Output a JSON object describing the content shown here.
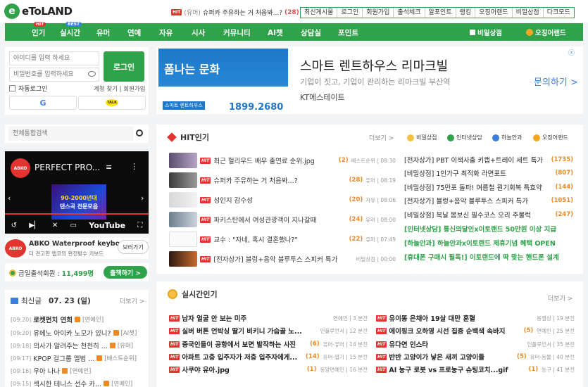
{
  "header": {
    "logo_text": "eToLAND",
    "logo_letter": "e",
    "ticker": {
      "badge": "HIT",
      "category": "(유머)",
      "title": "슈퍼카 주유하는 거 처음봐...?",
      "count": "(28)"
    },
    "top_links": [
      "최신게시물",
      "로그인",
      "회원가입",
      "출석체크",
      "알포인트",
      "랭킹",
      "오징어랜드",
      "비밀상점",
      "다크모드"
    ]
  },
  "nav": {
    "items": [
      {
        "label": "인기",
        "badge": "HIT"
      },
      {
        "label": "실시간",
        "badge": "BEST"
      },
      {
        "label": "유머"
      },
      {
        "label": "연예"
      },
      {
        "label": "자유"
      },
      {
        "label": "시사"
      },
      {
        "label": "커뮤니티"
      },
      {
        "label": "AI챗"
      },
      {
        "label": "상담실"
      },
      {
        "label": "포인트"
      }
    ],
    "right": [
      "비밀상점",
      "오징어랜드"
    ]
  },
  "login": {
    "id_placeholder": "아이디를 입력 하세요",
    "pw_placeholder": "비밀번호를 입력하세요",
    "button": "로그인",
    "auto_login": "자동로그인",
    "find_account": "계정 찾기 | 회원가입",
    "google": "G",
    "kakao": "TALK"
  },
  "search": {
    "placeholder": "전체통합검색"
  },
  "video": {
    "channel_logo": "ABKO",
    "title": "PERFECT PRO...",
    "art_line1": "90-2000년대",
    "art_line2": "댄스곡 전문모음",
    "youtube": "YouTube"
  },
  "ad_abko": {
    "logo": "ABKO",
    "title": "ABKO Waterproof keybo...",
    "subtitle": "더 견고한 앱코의 완전방수 키보드",
    "button": "보러가기"
  },
  "attendance": {
    "label": "금일출석회원 :",
    "count": "11,499명",
    "button": "출책하기 >"
  },
  "latest": {
    "heading": "최신글",
    "date": "07. 23 (일)",
    "more": "더보기 >",
    "rows": [
      {
        "time": "[09:20]",
        "title": "로켓펀치 연희",
        "cat": "[연예인]",
        "bold": true
      },
      {
        "time": "[09:20]",
        "title": "유메노 아이카 노모가 있니?",
        "cat": "[AI챗]",
        "bold": false
      },
      {
        "time": "[09:18]",
        "title": "의사가 알려주는 천천히 ...",
        "cat": "[유머]",
        "bold": false
      },
      {
        "time": "[09:17]",
        "title": "KPOP 걸그룹 앨범 ...",
        "cat": "[베스트순위]",
        "bold": false
      },
      {
        "time": "[09:16]",
        "title": "우아 나나",
        "cat": "[연예인]",
        "bold": false
      },
      {
        "time": "[09:15]",
        "title": "섹시한 테니스 선수 카...",
        "cat": "[연예인]",
        "bold": false
      }
    ]
  },
  "ad_banner": {
    "img_text": "폼나는 문화",
    "img_label": "스마트 렌트하우스",
    "img_phone": "1899.2680",
    "title": "스마트 렌트하우스 리마크빌",
    "desc": "기업이 짓고, 기업이 관리하는 리마크빌 부산역",
    "brand": "KT에스테이트",
    "cta": "문의하기 >",
    "close": "ⓧ"
  },
  "hit": {
    "title": "HIT인기",
    "more": "더보기 >",
    "tags": [
      "비밀상점",
      "인터넷상담",
      "하늘안과",
      "오징어랜드"
    ],
    "rows": [
      {
        "title": "최근 헐리우드 배우 출연료 순위.jpg",
        "count": "(2)",
        "meta": "베스트순위 | 08:30"
      },
      {
        "title": "슈퍼카 주유하는 거 처음봐...?",
        "count": "(28)",
        "meta": "유머 | 08:19"
      },
      {
        "title": "성인지 감수성",
        "count": "(20)",
        "meta": "자유 | 08:06"
      },
      {
        "title": "파키스탄에서 여성관광객이 지나갈때",
        "count": "(24)",
        "meta": "유머 | 08:00"
      },
      {
        "title": "교수 : \"자네, 혹시 결혼했나?\"",
        "count": "(22)",
        "meta": "유머 | 07:49"
      },
      {
        "title": "[전자상가] 블렁+음악 블루투스 스피커 특가",
        "count": "",
        "meta": "비밀상점 | 00:00"
      }
    ],
    "links": [
      {
        "title": "[전자상가] PBT 이색사출 키캡+트레이 세트 특가",
        "count": "(1735)",
        "style": "dark"
      },
      {
        "title": "[비밀상점] 1인가구 최적화 라면포트",
        "count": "(807)",
        "style": "dark"
      },
      {
        "title": "[비밀상점] 75만포 돌파! 여름철 원기회복 특효약",
        "count": "(144)",
        "style": "dark"
      },
      {
        "title": "[전자상가] 블렁+음악 블루투스 스피커 특가",
        "count": "(1051)",
        "style": "dark"
      },
      {
        "title": "[비밀상점] 복날 몸보신 필수코스 오리 주물럭",
        "count": "(247)",
        "style": "dark"
      },
      {
        "title": "[인터넷상담] 통신의달인x이토랜드 50만원 이상 지급",
        "count": "",
        "style": "green"
      },
      {
        "title": "[하늘안과] 하늘안과x이토랜드 제휴기념 혜택 OPEN",
        "count": "",
        "style": "green"
      },
      {
        "title": "[휴대폰 구매시 필독!] 이토랜드에 딱 맞는 핸드폰 설계",
        "count": "",
        "style": "green"
      }
    ]
  },
  "realtime": {
    "title": "실시간인기",
    "more": "더보기 >",
    "left": [
      {
        "title": "남자 얼굴 안 보는 미주",
        "count": "",
        "meta": "연예인 | 3 분전"
      },
      {
        "title": "실버 버튼 언박싱 딸기 비키니 가슴골 노...",
        "count": "",
        "meta": "인플루언서 | 12 분전"
      },
      {
        "title": "중국인들이 공항에서 보면 발작하는 사진",
        "count": "(6)",
        "meta": "유머-유머 | 14 분전"
      },
      {
        "title": "아파트 고층 입주자가 저층 입주자에게...",
        "count": "(14)",
        "meta": "유머-엽기 | 15 분전"
      },
      {
        "title": "사쿠야 유아.jpg",
        "count": "(1)",
        "meta": "동양연예인 | 16 분전"
      }
    ],
    "right": [
      {
        "title": "유이똥 은채아 19살 대만 훈혈",
        "count": "",
        "meta": "동영상 | 19 분전"
      },
      {
        "title": "에이핑크 오하영 시선 집중 순백색 속바지",
        "count": "(5)",
        "meta": "연예인 | 25 분전"
      },
      {
        "title": "유다연 인스타",
        "count": "",
        "meta": "인플루언서 | 35 분전"
      },
      {
        "title": "반반 고양이가 낳은 새끼 고양이들",
        "count": "(5)",
        "meta": "유머-동물 | 40 분전"
      },
      {
        "title": "AI 농구 로봇 vs 프로농구 슈팅코치...gif",
        "count": "(1)",
        "meta": "농구 | 41 분전"
      }
    ]
  }
}
